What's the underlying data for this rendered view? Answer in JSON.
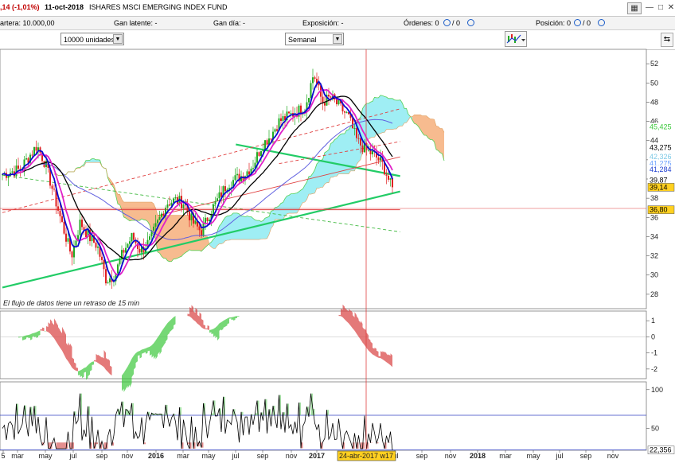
{
  "title": {
    "change": ",14 (-1,01%)",
    "date": "11-oct-2018",
    "instrument": "ISHARES MSCI EMERGING INDEX FUND"
  },
  "window_icons": {
    "grid": "grid-icon",
    "minimize": "minimize-icon",
    "maximize": "maximize-icon",
    "close": "close-icon"
  },
  "window_buttons": {
    "grid": "▦",
    "minimize": "—",
    "maximize": "□",
    "close": "✕"
  },
  "info": {
    "cartera": "artera: 10.000,00",
    "gan_latente": "Gan latente: -",
    "gan_dia": "Gan día: -",
    "exposicion": "Exposición: -",
    "ordenes": "Órdenes: 0",
    "ordenes_sep": "/ 0",
    "posicion": "Posición: 0",
    "posicion_sep": "/ 0"
  },
  "toolbar": {
    "units": "10000 unidades",
    "period": "Semanal"
  },
  "notice": "El flujo de datos tiene un retraso de 15 min",
  "crosshair_label": "24-abr-2017 w17",
  "price_labels": [
    {
      "text": "45,425",
      "value": 45.425,
      "color": "#3cc83c",
      "bg": "#ffffff"
    },
    {
      "text": "43,275",
      "value": 43.275,
      "color": "#000000",
      "bg": "#ffffff"
    },
    {
      "text": "42,326",
      "value": 42.326,
      "color": "#7ecae6",
      "bg": "#ffffff"
    },
    {
      "text": "41,275",
      "value": 41.6,
      "color": "#6aa0ff",
      "bg": "#ffffff"
    },
    {
      "text": "41,284",
      "value": 41.0,
      "color": "#2040d0",
      "bg": "#ffffff"
    },
    {
      "text": "39,87",
      "value": 39.87,
      "color": "#000000",
      "bg": "#ffffff"
    },
    {
      "text": "39,14",
      "value": 39.14,
      "color": "#000000",
      "bg": "#ffd020"
    },
    {
      "text": "36,80",
      "value": 36.8,
      "color": "#000000",
      "bg": "#ffd020"
    }
  ],
  "panel2_label": "",
  "panel3_label": {
    "text": "22,356",
    "value": 22.356
  },
  "chart_data": [
    {
      "type": "candlestick",
      "title": "ISHARES MSCI EMERGING INDEX FUND",
      "ylim": [
        26.5,
        53.5
      ],
      "yticks": [
        28,
        30,
        32,
        34,
        36,
        38,
        40,
        42,
        44,
        46,
        48,
        50,
        52
      ],
      "x_tick_labels": [
        "5",
        "mar",
        "may",
        "jul",
        "sep",
        "nov",
        "2016",
        "mar",
        "may",
        "jul",
        "sep",
        "nov",
        "2017",
        "jul",
        "sep",
        "nov",
        "2018",
        "mar",
        "may",
        "jul",
        "sep",
        "nov"
      ],
      "bold_tick_labels": [
        "2016",
        "2017",
        "2018"
      ],
      "weekly_close_anchors": [
        [
          "2015-01",
          40.5
        ],
        [
          "2015-03",
          41.0
        ],
        [
          "2015-05",
          43.5
        ],
        [
          "2015-06",
          41.5
        ],
        [
          "2015-08",
          35.0
        ],
        [
          "2015-09",
          32.0
        ],
        [
          "2015-10",
          35.5
        ],
        [
          "2015-11",
          34.0
        ],
        [
          "2015-12",
          33.0
        ],
        [
          "2016-01",
          29.5
        ],
        [
          "2016-02",
          30.0
        ],
        [
          "2016-03",
          32.5
        ],
        [
          "2016-04",
          34.0
        ],
        [
          "2016-05",
          32.5
        ],
        [
          "2016-06",
          33.5
        ],
        [
          "2016-07",
          35.5
        ],
        [
          "2016-08",
          37.5
        ],
        [
          "2016-09",
          37.8
        ],
        [
          "2016-10",
          37.5
        ],
        [
          "2016-11",
          35.5
        ],
        [
          "2016-12",
          34.5
        ],
        [
          "2017-01",
          36.5
        ],
        [
          "2017-02",
          38.0
        ],
        [
          "2017-03",
          39.5
        ],
        [
          "2017-05",
          40.5
        ],
        [
          "2017-06",
          41.5
        ],
        [
          "2017-07",
          43.5
        ],
        [
          "2017-08",
          44.5
        ],
        [
          "2017-09",
          46.0
        ],
        [
          "2017-10",
          46.5
        ],
        [
          "2017-11",
          47.0
        ],
        [
          "2017-12",
          47.5
        ],
        [
          "2018-01",
          51.0
        ],
        [
          "2018-02",
          48.0
        ],
        [
          "2018-03",
          48.5
        ],
        [
          "2018-04",
          47.5
        ],
        [
          "2018-05",
          46.5
        ],
        [
          "2018-06",
          44.0
        ],
        [
          "2018-07",
          43.0
        ],
        [
          "2018-08",
          42.5
        ],
        [
          "2018-09",
          41.5
        ],
        [
          "2018-10",
          39.14
        ]
      ],
      "series": [
        {
          "name": "",
          "color": "#0a0ad0",
          "role": "short moving average"
        },
        {
          "name": "",
          "color": "#e020c8",
          "role": "fast moving average"
        },
        {
          "name": "",
          "color": "#000000",
          "role": "slow line"
        },
        {
          "name": "",
          "color": "#6060e0",
          "role": "long moving average"
        }
      ],
      "trendlines": [
        {
          "color": "#22cc66",
          "from": [
            "2015-01",
            28.7
          ],
          "to": [
            "2018-11",
            38.7
          ]
        },
        {
          "color": "#22cc66",
          "from": [
            "2017-04",
            43.6
          ],
          "to": [
            "2018-11",
            40.3
          ]
        },
        {
          "color": "#e04040",
          "dashed": true,
          "from": [
            "2015-01",
            36.5
          ],
          "to": [
            "2018-11",
            47.3
          ]
        },
        {
          "color": "#e04040",
          "dashed": false,
          "from": [
            "2016-07",
            36.2
          ],
          "to": [
            "2018-11",
            42.3
          ]
        },
        {
          "color": "#44bb44",
          "dashed": true,
          "from": [
            "2015-01",
            40.4
          ],
          "to": [
            "2018-11",
            34.5
          ]
        },
        {
          "color": "#e04040",
          "dashed": true,
          "from": [
            "2017-09",
            41.6
          ],
          "to": [
            "2018-11",
            43.9
          ]
        },
        {
          "color": "#e04040",
          "dashed": false,
          "from": [
            "2015-01",
            36.8
          ],
          "to": [
            "2018-11",
            36.8
          ]
        }
      ]
    },
    {
      "type": "area",
      "title": "",
      "ylim": [
        -2.6,
        1.6
      ],
      "yticks": [
        -2,
        -1,
        0,
        1
      ]
    },
    {
      "type": "line",
      "title": "",
      "ylim": [
        22,
        110
      ],
      "yticks": [
        50,
        100
      ],
      "bands": [
        67,
        22.356
      ],
      "last": 22.356
    }
  ],
  "colors": {
    "bull": "#22aa22",
    "bear": "#e02020",
    "cloud_up": "#7fe8f0",
    "cloud_down": "#f4a46a",
    "crosshair": "#e04040"
  }
}
